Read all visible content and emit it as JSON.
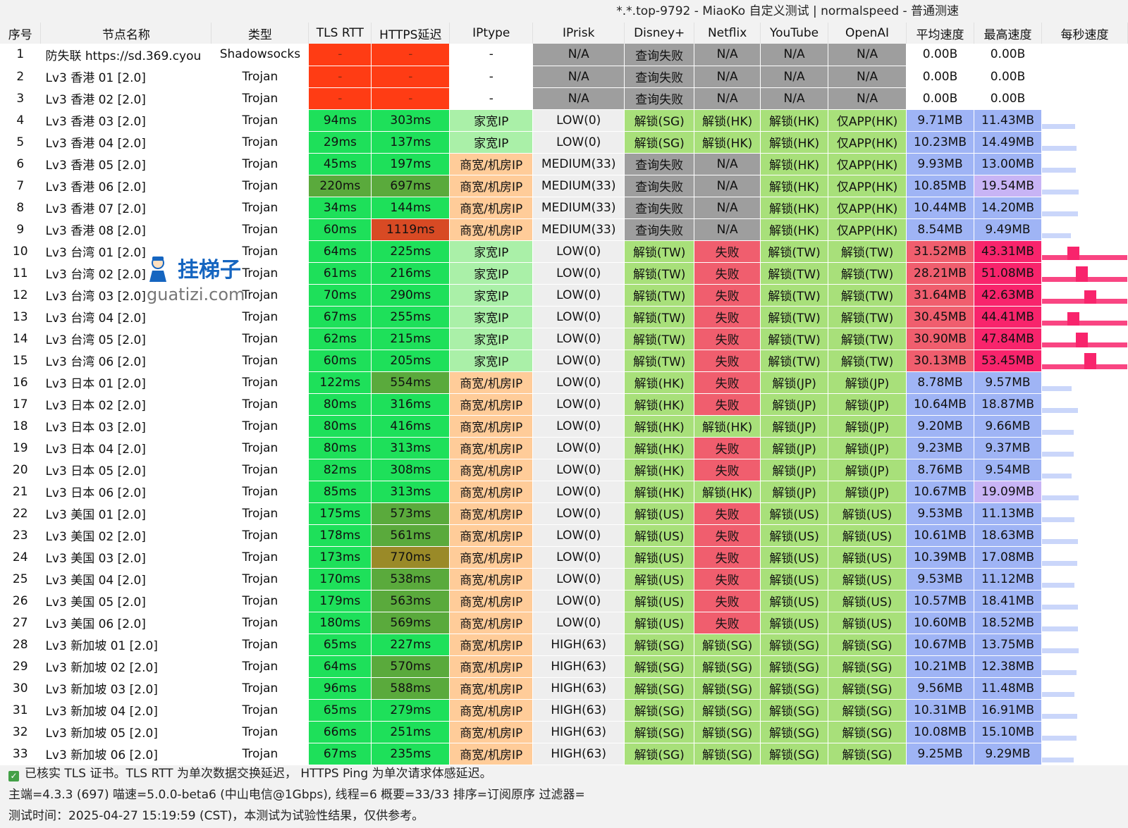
{
  "window_title": "*.*.top-9792 - MiaoKo 自定义测试 | normalspeed - 普通测速",
  "columns": [
    "序号",
    "节点名称",
    "类型",
    "TLS RTT",
    "HTTPS延迟",
    "IPtype",
    "IPrisk",
    "Disney+",
    "Netflix",
    "YouTube",
    "OpenAI",
    "平均速度",
    "最高速度",
    "每秒速度"
  ],
  "colors": {
    "red": "#ff3c14",
    "green": "#1ee05a",
    "olive": "#5aaa3c",
    "darkolive": "#9a8a28",
    "brownred": "#d84a24",
    "peach": "#ffcc99",
    "mint": "#aaf0a8",
    "gray": "#9e9e9e",
    "lightgray": "#eeeeee",
    "lime": "#a8e07a",
    "pink": "#f05e6e",
    "blue": "#9fb4f5",
    "lavender": "#c8b4f5",
    "hotpink": "#f8246c",
    "white": "#ffffff"
  },
  "rows": [
    [
      "1",
      "防失联 https://sd.369.cyou",
      "Shadowsocks",
      "-",
      "-",
      "-",
      "N/A",
      "查询失败",
      "N/A",
      "N/A",
      "N/A",
      "0.00B",
      "0.00B"
    ],
    [
      "2",
      "Lv3 香港 01 [2.0]",
      "Trojan",
      "-",
      "-",
      "-",
      "N/A",
      "查询失败",
      "N/A",
      "N/A",
      "N/A",
      "0.00B",
      "0.00B"
    ],
    [
      "3",
      "Lv3 香港 02 [2.0]",
      "Trojan",
      "-",
      "-",
      "-",
      "N/A",
      "查询失败",
      "N/A",
      "N/A",
      "N/A",
      "0.00B",
      "0.00B"
    ],
    [
      "4",
      "Lv3 香港 03 [2.0]",
      "Trojan",
      "94ms",
      "303ms",
      "家宽IP",
      "LOW(0)",
      "解锁(SG)",
      "解锁(HK)",
      "解锁(HK)",
      "仅APP(HK)",
      "9.71MB",
      "11.43MB"
    ],
    [
      "5",
      "Lv3 香港 04 [2.0]",
      "Trojan",
      "29ms",
      "137ms",
      "家宽IP",
      "LOW(0)",
      "解锁(SG)",
      "解锁(HK)",
      "解锁(HK)",
      "仅APP(HK)",
      "10.23MB",
      "14.49MB"
    ],
    [
      "6",
      "Lv3 香港 05 [2.0]",
      "Trojan",
      "45ms",
      "197ms",
      "商宽/机房IP",
      "MEDIUM(33)",
      "查询失败",
      "N/A",
      "解锁(HK)",
      "仅APP(HK)",
      "9.93MB",
      "13.00MB"
    ],
    [
      "7",
      "Lv3 香港 06 [2.0]",
      "Trojan",
      "220ms",
      "697ms",
      "商宽/机房IP",
      "MEDIUM(33)",
      "查询失败",
      "N/A",
      "解锁(HK)",
      "仅APP(HK)",
      "10.85MB",
      "19.54MB"
    ],
    [
      "8",
      "Lv3 香港 07 [2.0]",
      "Trojan",
      "34ms",
      "144ms",
      "商宽/机房IP",
      "MEDIUM(33)",
      "查询失败",
      "N/A",
      "解锁(HK)",
      "仅APP(HK)",
      "10.44MB",
      "14.20MB"
    ],
    [
      "9",
      "Lv3 香港 08 [2.0]",
      "Trojan",
      "60ms",
      "1119ms",
      "商宽/机房IP",
      "MEDIUM(33)",
      "查询失败",
      "N/A",
      "解锁(HK)",
      "仅APP(HK)",
      "8.54MB",
      "9.49MB"
    ],
    [
      "10",
      "Lv3 台湾 01 [2.0]",
      "Trojan",
      "64ms",
      "225ms",
      "家宽IP",
      "LOW(0)",
      "解锁(TW)",
      "失败",
      "解锁(TW)",
      "解锁(TW)",
      "31.52MB",
      "43.31MB"
    ],
    [
      "11",
      "Lv3 台湾 02 [2.0]",
      "Trojan",
      "61ms",
      "216ms",
      "家宽IP",
      "LOW(0)",
      "解锁(TW)",
      "失败",
      "解锁(TW)",
      "解锁(TW)",
      "28.21MB",
      "51.08MB"
    ],
    [
      "12",
      "Lv3 台湾 03 [2.0]",
      "Trojan",
      "70ms",
      "290ms",
      "家宽IP",
      "LOW(0)",
      "解锁(TW)",
      "失败",
      "解锁(TW)",
      "解锁(TW)",
      "31.64MB",
      "42.63MB"
    ],
    [
      "13",
      "Lv3 台湾 04 [2.0]",
      "Trojan",
      "67ms",
      "255ms",
      "家宽IP",
      "LOW(0)",
      "解锁(TW)",
      "失败",
      "解锁(TW)",
      "解锁(TW)",
      "30.45MB",
      "44.41MB"
    ],
    [
      "14",
      "Lv3 台湾 05 [2.0]",
      "Trojan",
      "62ms",
      "215ms",
      "家宽IP",
      "LOW(0)",
      "解锁(TW)",
      "失败",
      "解锁(TW)",
      "解锁(TW)",
      "30.90MB",
      "47.84MB"
    ],
    [
      "15",
      "Lv3 台湾 06 [2.0]",
      "Trojan",
      "60ms",
      "205ms",
      "家宽IP",
      "LOW(0)",
      "解锁(TW)",
      "失败",
      "解锁(TW)",
      "解锁(TW)",
      "30.13MB",
      "53.45MB"
    ],
    [
      "16",
      "Lv3 日本 01 [2.0]",
      "Trojan",
      "122ms",
      "554ms",
      "商宽/机房IP",
      "LOW(0)",
      "解锁(HK)",
      "失败",
      "解锁(JP)",
      "解锁(JP)",
      "8.78MB",
      "9.57MB"
    ],
    [
      "17",
      "Lv3 日本 02 [2.0]",
      "Trojan",
      "80ms",
      "316ms",
      "商宽/机房IP",
      "LOW(0)",
      "解锁(HK)",
      "失败",
      "解锁(JP)",
      "解锁(JP)",
      "10.64MB",
      "18.87MB"
    ],
    [
      "18",
      "Lv3 日本 03 [2.0]",
      "Trojan",
      "80ms",
      "416ms",
      "商宽/机房IP",
      "LOW(0)",
      "解锁(HK)",
      "解锁(HK)",
      "解锁(JP)",
      "解锁(JP)",
      "9.20MB",
      "9.66MB"
    ],
    [
      "19",
      "Lv3 日本 04 [2.0]",
      "Trojan",
      "80ms",
      "313ms",
      "商宽/机房IP",
      "LOW(0)",
      "解锁(HK)",
      "失败",
      "解锁(JP)",
      "解锁(JP)",
      "9.23MB",
      "9.37MB"
    ],
    [
      "20",
      "Lv3 日本 05 [2.0]",
      "Trojan",
      "82ms",
      "308ms",
      "商宽/机房IP",
      "LOW(0)",
      "解锁(HK)",
      "失败",
      "解锁(JP)",
      "解锁(JP)",
      "8.76MB",
      "9.54MB"
    ],
    [
      "21",
      "Lv3 日本 06 [2.0]",
      "Trojan",
      "85ms",
      "313ms",
      "商宽/机房IP",
      "LOW(0)",
      "解锁(HK)",
      "解锁(HK)",
      "解锁(JP)",
      "解锁(JP)",
      "10.67MB",
      "19.09MB"
    ],
    [
      "22",
      "Lv3 美国 01 [2.0]",
      "Trojan",
      "175ms",
      "573ms",
      "商宽/机房IP",
      "LOW(0)",
      "解锁(US)",
      "失败",
      "解锁(US)",
      "解锁(US)",
      "9.53MB",
      "11.13MB"
    ],
    [
      "23",
      "Lv3 美国 02 [2.0]",
      "Trojan",
      "178ms",
      "561ms",
      "商宽/机房IP",
      "LOW(0)",
      "解锁(US)",
      "失败",
      "解锁(US)",
      "解锁(US)",
      "10.61MB",
      "18.63MB"
    ],
    [
      "24",
      "Lv3 美国 03 [2.0]",
      "Trojan",
      "173ms",
      "770ms",
      "商宽/机房IP",
      "LOW(0)",
      "解锁(US)",
      "失败",
      "解锁(US)",
      "解锁(US)",
      "10.39MB",
      "17.08MB"
    ],
    [
      "25",
      "Lv3 美国 04 [2.0]",
      "Trojan",
      "170ms",
      "538ms",
      "商宽/机房IP",
      "LOW(0)",
      "解锁(US)",
      "失败",
      "解锁(US)",
      "解锁(US)",
      "9.53MB",
      "11.12MB"
    ],
    [
      "26",
      "Lv3 美国 05 [2.0]",
      "Trojan",
      "179ms",
      "563ms",
      "商宽/机房IP",
      "LOW(0)",
      "解锁(US)",
      "失败",
      "解锁(US)",
      "解锁(US)",
      "10.57MB",
      "18.41MB"
    ],
    [
      "27",
      "Lv3 美国 06 [2.0]",
      "Trojan",
      "180ms",
      "569ms",
      "商宽/机房IP",
      "LOW(0)",
      "解锁(US)",
      "失败",
      "解锁(US)",
      "解锁(US)",
      "10.60MB",
      "18.52MB"
    ],
    [
      "28",
      "Lv3 新加坡 01 [2.0]",
      "Trojan",
      "65ms",
      "227ms",
      "商宽/机房IP",
      "HIGH(63)",
      "解锁(SG)",
      "解锁(SG)",
      "解锁(SG)",
      "解锁(SG)",
      "10.67MB",
      "13.75MB"
    ],
    [
      "29",
      "Lv3 新加坡 02 [2.0]",
      "Trojan",
      "64ms",
      "570ms",
      "商宽/机房IP",
      "HIGH(63)",
      "解锁(SG)",
      "解锁(SG)",
      "解锁(SG)",
      "解锁(SG)",
      "10.21MB",
      "12.38MB"
    ],
    [
      "30",
      "Lv3 新加坡 03 [2.0]",
      "Trojan",
      "96ms",
      "588ms",
      "商宽/机房IP",
      "HIGH(63)",
      "解锁(SG)",
      "解锁(SG)",
      "解锁(SG)",
      "解锁(SG)",
      "9.56MB",
      "11.48MB"
    ],
    [
      "31",
      "Lv3 新加坡 04 [2.0]",
      "Trojan",
      "65ms",
      "279ms",
      "商宽/机房IP",
      "HIGH(63)",
      "解锁(SG)",
      "解锁(SG)",
      "解锁(SG)",
      "解锁(SG)",
      "10.31MB",
      "16.91MB"
    ],
    [
      "32",
      "Lv3 新加坡 05 [2.0]",
      "Trojan",
      "66ms",
      "251ms",
      "商宽/机房IP",
      "HIGH(63)",
      "解锁(SG)",
      "解锁(SG)",
      "解锁(SG)",
      "解锁(SG)",
      "10.08MB",
      "15.10MB"
    ],
    [
      "33",
      "Lv3 新加坡 06 [2.0]",
      "Trojan",
      "67ms",
      "235ms",
      "商宽/机房IP",
      "HIGH(63)",
      "解锁(SG)",
      "解锁(SG)",
      "解锁(SG)",
      "解锁(SG)",
      "9.25MB",
      "9.29MB"
    ]
  ],
  "footer": {
    "line1": "已核实 TLS 证书。TLS RTT 为单次数据交换延迟， HTTPS Ping 为单次请求体感延迟。",
    "line2": "主端=4.3.3 (697) 喵速=5.0.0-beta6 (中山电信@1Gbps), 线程=6 概要=33/33 排序=订阅原序 过滤器=",
    "line3": "测试时间：2025-04-27 15:19:59 (CST)，本测试为试验性结果，仅供参考。"
  },
  "watermark": {
    "text": "挂梯子",
    "url": "guatizi.com"
  }
}
